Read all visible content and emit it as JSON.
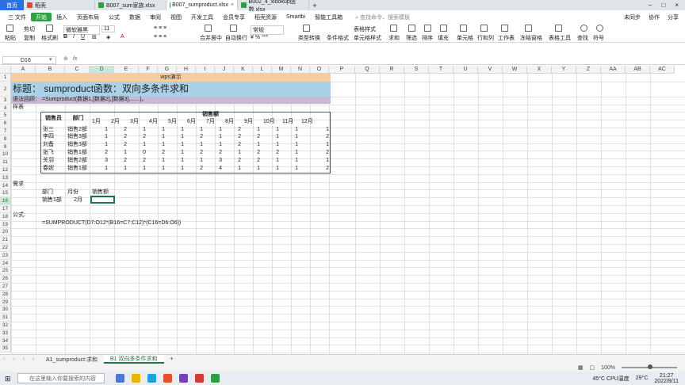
{
  "tabs": {
    "home": "首页",
    "items": [
      {
        "label": "稻壳",
        "color": "#e0463e"
      },
      {
        "label": "B007_sum家族.xlsx",
        "color": "#2ea043"
      },
      {
        "label": "B007_sumproduct.xlsx",
        "color": "#2ea043"
      },
      {
        "label": "B002_4_xlookup函数.xlsx",
        "color": "#2ea043"
      }
    ],
    "new_tab": "+"
  },
  "menu": {
    "file": "三 文件",
    "items": [
      "开始",
      "插入",
      "页面布局",
      "公式",
      "数据",
      "审阅",
      "视图",
      "开发工具",
      "会员专享",
      "稻壳资源",
      "Smartbi",
      "智能工具箱"
    ],
    "active": "开始",
    "search": "查找命令、搜索模板",
    "right": [
      "未同步",
      "协作",
      "分享"
    ]
  },
  "ribbon": {
    "top_row": [
      "微软雅黑",
      "11",
      "常规",
      "表格样式",
      "求和",
      "筛选",
      "排序",
      "填充",
      "单元格",
      "行和列",
      "工作表",
      "冻结窗格",
      "表格工具",
      "查找",
      "符号"
    ],
    "labels": [
      "粘贴",
      "剪切",
      "格式刷",
      "复制",
      "合并居中",
      "自动换行",
      "类型转换",
      "条件格式",
      "单元格样式"
    ]
  },
  "formula_bar": {
    "cell_ref": "D16",
    "fx": "fx",
    "content": ""
  },
  "columns": [
    "A",
    "B",
    "C",
    "D",
    "E",
    "F",
    "G",
    "H",
    "I",
    "J",
    "K",
    "L",
    "M",
    "N",
    "O",
    "P",
    "Q",
    "R",
    "S",
    "T",
    "U",
    "V",
    "W",
    "X",
    "Y",
    "Z",
    "AA",
    "AB",
    "AC"
  ],
  "rows": [
    "1",
    "2",
    "3",
    "4",
    "5",
    "6",
    "7",
    "8",
    "9",
    "10",
    "11",
    "12",
    "13",
    "14",
    "15",
    "16",
    "17",
    "18",
    "19",
    "20",
    "21",
    "22",
    "23",
    "24",
    "25",
    "26",
    "27",
    "28",
    "29",
    "30",
    "31",
    "32",
    "33",
    "34",
    "35"
  ],
  "sheet": {
    "banner": "wps演示",
    "title": "标题：  sumproduct函数：双向多条件求和",
    "syntax": "语法回顾：  =Sumproduct(数据1,[数据2],[数据3],......)。",
    "sample_label": "样表",
    "header_person": "销售员",
    "header_dept": "部门",
    "header_sales": "销售额",
    "months": [
      "1月",
      "2月",
      "3月",
      "4月",
      "5月",
      "6月",
      "7月",
      "8月",
      "9月",
      "10月",
      "11月",
      "12月"
    ],
    "rows": [
      {
        "name": "张三",
        "dept": "销售2部",
        "values": [
          1,
          2,
          1,
          1,
          1,
          1,
          1,
          2,
          1,
          1,
          1,
          1
        ]
      },
      {
        "name": "李四",
        "dept": "销售3部",
        "values": [
          1,
          2,
          2,
          1,
          1,
          2,
          1,
          2,
          2,
          1,
          1,
          2
        ]
      },
      {
        "name": "刘备",
        "dept": "销售3部",
        "values": [
          1,
          2,
          1,
          1,
          1,
          1,
          1,
          2,
          1,
          1,
          1,
          1
        ]
      },
      {
        "name": "张飞",
        "dept": "销售1部",
        "values": [
          2,
          1,
          0,
          2,
          1,
          2,
          2,
          1,
          2,
          2,
          1,
          2
        ]
      },
      {
        "name": "关羽",
        "dept": "销售2部",
        "values": [
          3,
          2,
          2,
          1,
          1,
          1,
          3,
          2,
          2,
          1,
          1,
          1
        ]
      },
      {
        "name": "春妮",
        "dept": "销售1部",
        "values": [
          1,
          1,
          1,
          1,
          1,
          2,
          4,
          1,
          1,
          1,
          1,
          2
        ]
      }
    ],
    "req_label": "需求",
    "req_headers": [
      "部门",
      "月份",
      "销售额"
    ],
    "req_values": [
      "销售1部",
      "2月",
      ""
    ],
    "formula_label": "公式:",
    "formula": "=SUMPRODUCT(D7:O12*(B16=C7:C12)*(C16=D6:O6))"
  },
  "sheet_tabs": [
    "A1_sumproduct:求和",
    "B1 双向多条件求和"
  ],
  "active_sheet": "B1 双向多条件求和",
  "status": {
    "zoom": "100%"
  },
  "taskbar": {
    "search": "在这里输入你要搜索的内容",
    "temp": "29°C",
    "cpu": "45°C CPU温度",
    "time": "21:27",
    "date": "2022/8/11"
  }
}
